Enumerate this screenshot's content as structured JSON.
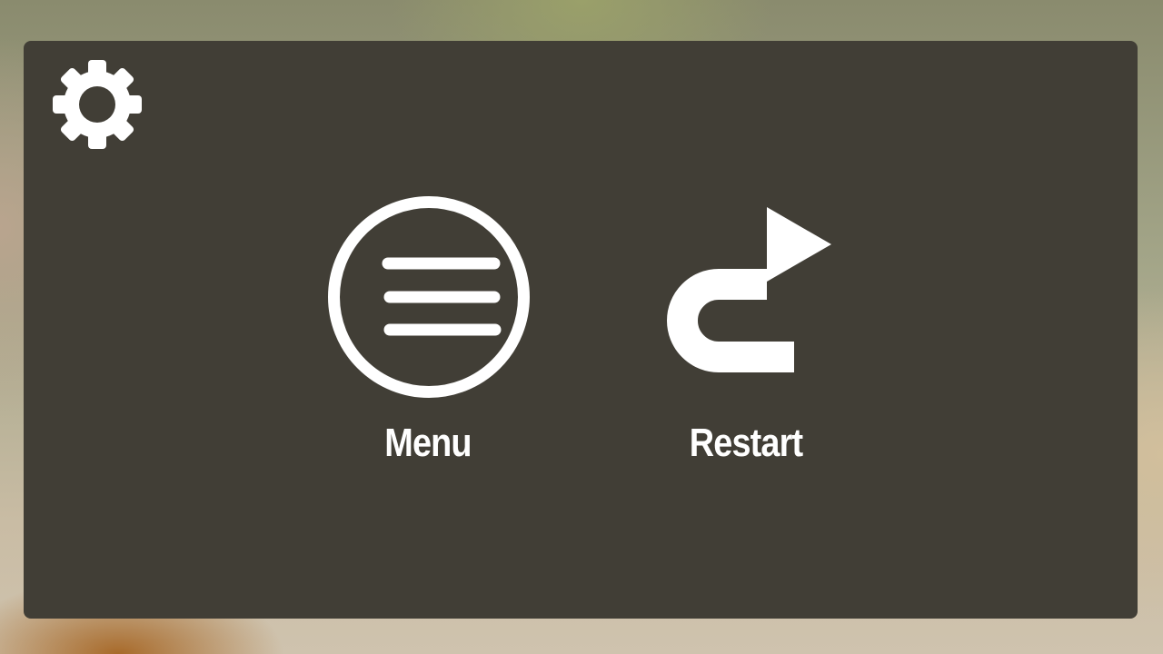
{
  "pause_menu": {
    "settings_icon": "gear-icon",
    "buttons": [
      {
        "label": "Menu",
        "icon": "hamburger-circle-icon"
      },
      {
        "label": "Restart",
        "icon": "restart-arrow-icon"
      }
    ]
  },
  "colors": {
    "panel": "#413e36",
    "foreground": "#ffffff"
  }
}
